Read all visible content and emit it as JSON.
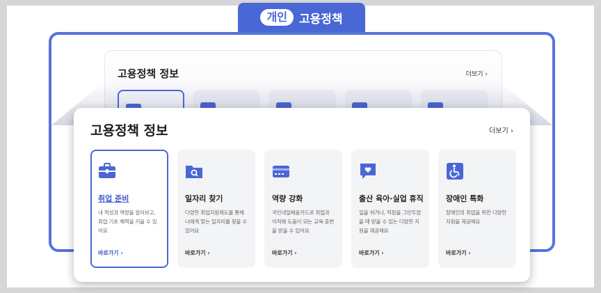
{
  "header": {
    "pill": "개인",
    "title": "고용정책"
  },
  "panel": {
    "title": "고용정책 정보",
    "more": "더보기 ›"
  },
  "cards": [
    {
      "title": "취업 준비",
      "desc": "내 적성과 역량을 알아보고, 취업 기초 체력을 키울 수 있어요",
      "go": "바로가기 ›",
      "icon": "briefcase-icon"
    },
    {
      "title": "일자리 찾기",
      "desc": "다양한 취업지원제도를 통해 나에게 맞는 일자리를 찾을 수 있어요",
      "go": "바로가기 ›",
      "icon": "search-folder-icon"
    },
    {
      "title": "역량 강화",
      "desc": "국민내일배움카드로 취업과 이직에 도움이 되는 교육·훈련을 받을 수 있어요",
      "go": "바로가기 ›",
      "icon": "card-icon"
    },
    {
      "title": "출산 육아·실업 휴직",
      "desc": "일을 쉬거나, 직장을 그만두었을 때 받을 수 있는 다양한 지원을 제공해요",
      "go": "바로가기 ›",
      "icon": "heart-message-icon"
    },
    {
      "title": "장애인 특화",
      "desc": "장애인의 취업을 위한 다양한 지원을 제공해요",
      "go": "바로가기 ›",
      "icon": "wheelchair-icon"
    }
  ],
  "colors": {
    "accent": "#4a67d6",
    "frame": "#5672dc"
  }
}
